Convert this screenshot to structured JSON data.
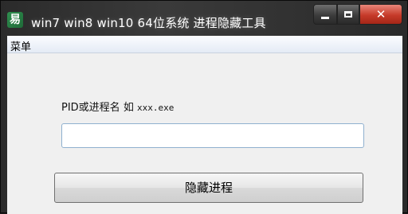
{
  "window": {
    "title": "win7  win8  win10   64位系统 进程隐藏工具",
    "icon": "app-icon",
    "controls": {
      "minimize": "minimize-icon",
      "maximize": "maximize-icon",
      "close_glyph": "✕"
    }
  },
  "menubar": {
    "items": [
      {
        "label": "菜单"
      }
    ]
  },
  "form": {
    "label_prefix": "PID或进程名 如 ",
    "label_example": "xxx.exe",
    "input_value": "",
    "submit_label": "隐藏进程"
  },
  "colors": {
    "titlebar": "#2b2b2b",
    "client_bg": "#f0f0f0",
    "close_button": "#c63b2a",
    "input_border": "#8fb0cf"
  }
}
